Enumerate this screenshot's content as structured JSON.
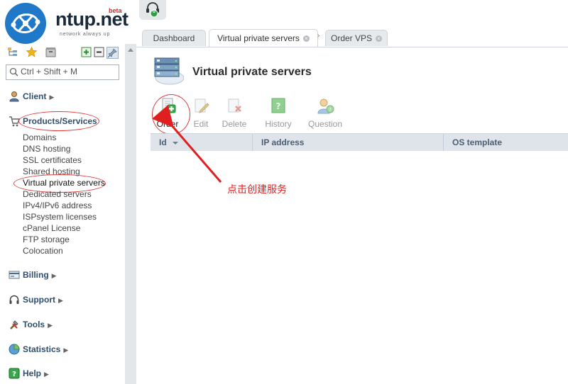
{
  "brand": {
    "name": "ntup.net",
    "beta": "beta",
    "tagline": "network always up"
  },
  "sidebar": {
    "search_placeholder": "Ctrl + Shift + M",
    "sections": {
      "client": "Client",
      "products": "Products/Services",
      "billing": "Billing",
      "support": "Support",
      "tools": "Tools",
      "statistics": "Statistics",
      "help": "Help"
    },
    "product_items": [
      "Domains",
      "DNS hosting",
      "SSL certificates",
      "Shared hosting",
      "Virtual private servers",
      "Dedicated servers",
      "IPv4/IPv6 address",
      "ISPsystem licenses",
      "cPanel License",
      "FTP storage",
      "Colocation"
    ]
  },
  "notifications": {
    "count": "0"
  },
  "tabs": [
    {
      "label": "Dashboard"
    },
    {
      "label": "Virtual private servers"
    },
    {
      "label": "Order VPS"
    }
  ],
  "page": {
    "title": "Virtual private servers",
    "toolbar": {
      "order": "Order",
      "edit": "Edit",
      "delete": "Delete",
      "history": "History",
      "question": "Question"
    },
    "table": {
      "columns": [
        "Id",
        "IP address",
        "OS template"
      ]
    }
  },
  "annotation": {
    "text": "点击创建服务",
    "color": "#e02020"
  },
  "colors": {
    "accent": "#2d4e6e",
    "highlight": "#e03a3a",
    "order_icon": "#2db34a"
  }
}
